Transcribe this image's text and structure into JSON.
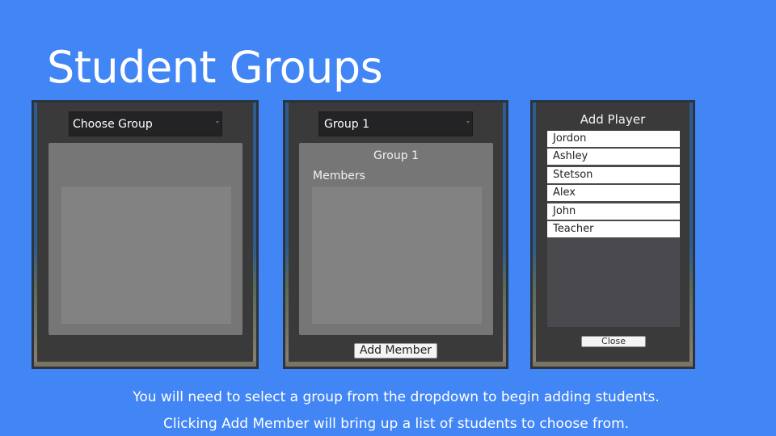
{
  "slide": {
    "title": "Student Groups",
    "caption_line1": "You will need to select a group from the dropdown to begin adding students.",
    "caption_line2": "Clicking Add Member will bring up a list of students to choose from."
  },
  "panel_choose": {
    "dropdown_value": "Choose Group"
  },
  "panel_group": {
    "dropdown_value": "Group 1",
    "group_name": "Group 1",
    "members_label": "Members",
    "add_member_label": "Add Member"
  },
  "panel_add_player": {
    "title": "Add Player",
    "players": [
      "Jordon",
      "Ashley",
      "Stetson",
      "Alex",
      "John",
      "Teacher"
    ],
    "close_label": "Close"
  },
  "colors": {
    "background": "#4285f4",
    "panel": "#39393b",
    "group_box": "#767676"
  }
}
